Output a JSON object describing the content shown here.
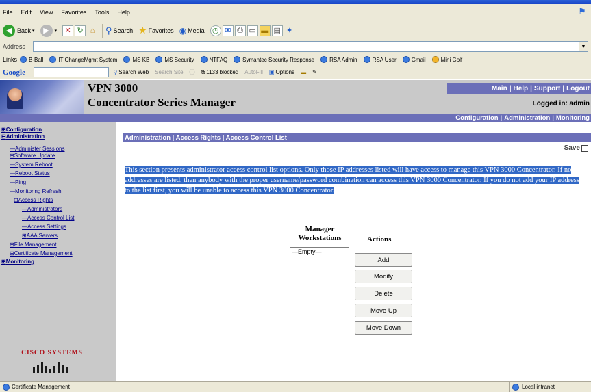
{
  "browser": {
    "menu": [
      "File",
      "Edit",
      "View",
      "Favorites",
      "Tools",
      "Help"
    ],
    "toolbar": {
      "back_label": "Back",
      "search_label": "Search",
      "favorites_label": "Favorites",
      "media_label": "Media"
    },
    "address": {
      "label": "Address",
      "value": ""
    },
    "links": {
      "label": "Links",
      "items": [
        "B-Ball",
        "IT ChangeMgmt System",
        "MS KB",
        "MS Security",
        "NTFAQ",
        "Symantec Security Response",
        "RSA Admin",
        "RSA User",
        "Gmail",
        "Mini Golf"
      ]
    },
    "google": {
      "logo": "Google -",
      "search_web": "Search Web",
      "search_site": "Search Site",
      "popups_blocked": "1133 blocked",
      "autofill": "AutoFill",
      "options": "Options"
    },
    "status": {
      "text": "Certificate Management",
      "zone": "Local intranet"
    }
  },
  "banner": {
    "title_line1": "VPN 3000",
    "title_line2": "Concentrator Series Manager",
    "top_links": [
      "Main",
      "Help",
      "Support",
      "Logout"
    ],
    "logged_in": "Logged in: admin",
    "nav": [
      "Configuration",
      "Administration",
      "Monitoring"
    ]
  },
  "tree": [
    {
      "label": "Configuration",
      "prefix": "⊞",
      "bold": true
    },
    {
      "label": "Administration",
      "prefix": "⊟",
      "bold": true
    },
    {
      "label": "Administer Sessions",
      "prefix": "—",
      "bold": false
    },
    {
      "label": "Software Update",
      "prefix": "⊞",
      "bold": false
    },
    {
      "label": "System Reboot",
      "prefix": "—",
      "bold": false
    },
    {
      "label": "Reboot Status",
      "prefix": "—",
      "bold": false
    },
    {
      "label": "Ping",
      "prefix": "—",
      "bold": false
    },
    {
      "label": "Monitoring Refresh",
      "prefix": "—",
      "bold": false
    },
    {
      "label": "Access Rights",
      "prefix": "⊟",
      "bold": false
    },
    {
      "label": "Administrators",
      "prefix": "—",
      "bold": false
    },
    {
      "label": "Access Control List",
      "prefix": "—",
      "bold": false
    },
    {
      "label": "Access Settings",
      "prefix": "—",
      "bold": false
    },
    {
      "label": "AAA Servers",
      "prefix": "⊞",
      "bold": false
    },
    {
      "label": "File Management",
      "prefix": "⊞",
      "bold": false
    },
    {
      "label": "Certificate Management",
      "prefix": "⊞",
      "bold": false
    },
    {
      "label": "Monitoring",
      "prefix": "⊞",
      "bold": true
    }
  ],
  "cisco": {
    "logo_text": "CISCO SYSTEMS"
  },
  "main": {
    "breadcrumb": "Administration | Access Rights | Access Control List",
    "save_label": "Save",
    "description": "This section presents administrator access control list options. Only those IP addresses listed will have access to manage this VPN 3000 Concentrator. If no addresses are listed, then anybody with the proper username/password combination can access this VPN 3000 Concentrator. If you do not add your IP address to the list first, you will be unable to access this VPN 3000 Concentrator.",
    "manager_header": "Manager Workstations",
    "actions_header": "Actions",
    "list_items": [
      "—Empty—"
    ],
    "buttons": {
      "add": "Add",
      "modify": "Modify",
      "delete": "Delete",
      "move_up": "Move Up",
      "move_down": "Move Down"
    }
  }
}
